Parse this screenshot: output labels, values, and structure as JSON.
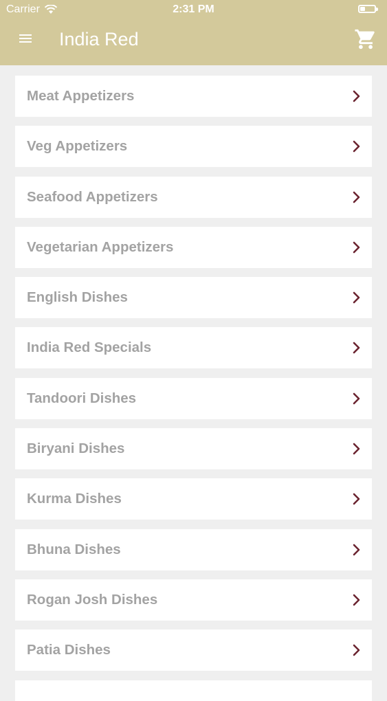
{
  "status_bar": {
    "carrier": "Carrier",
    "time": "2:31 PM",
    "wifi_icon": "wifi-icon",
    "battery_icon": "battery-icon"
  },
  "header": {
    "title": "India Red",
    "menu_icon": "hamburger-menu-icon",
    "cart_icon": "shopping-cart-icon",
    "background": "#d3c99b"
  },
  "categories": [
    {
      "label": "Meat Appetizers"
    },
    {
      "label": "Veg Appetizers"
    },
    {
      "label": "Seafood Appetizers"
    },
    {
      "label": "Vegetarian Appetizers"
    },
    {
      "label": "English Dishes"
    },
    {
      "label": "India Red Specials"
    },
    {
      "label": "Tandoori Dishes"
    },
    {
      "label": "Biryani Dishes"
    },
    {
      "label": "Kurma Dishes"
    },
    {
      "label": "Bhuna Dishes"
    },
    {
      "label": "Rogan Josh Dishes"
    },
    {
      "label": "Patia Dishes"
    }
  ],
  "colors": {
    "chevron": "#6b2430",
    "label": "#a3a3a3",
    "page_background": "#efefef"
  }
}
